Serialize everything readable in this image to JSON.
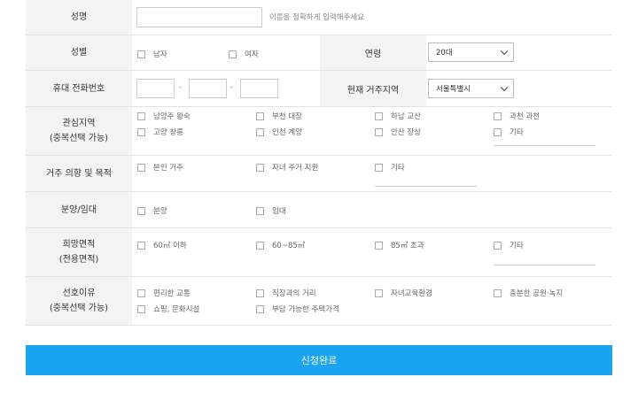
{
  "name": {
    "label": "성명",
    "placeholder": "",
    "hint": "이름을 정확하게 입력해주세요"
  },
  "gender": {
    "label": "성별",
    "options": [
      "남자",
      "여자"
    ]
  },
  "age": {
    "label": "연령",
    "selected": "20대"
  },
  "phone": {
    "label": "휴대 전화번호",
    "sep": "-"
  },
  "residence": {
    "label": "현재 거주지역",
    "selected": "서울특별시"
  },
  "interest_area": {
    "label_lines": [
      "관심지역",
      "(중복선택 가능)"
    ],
    "options": [
      "남양주 왕숙",
      "부천 대장",
      "하남 교산",
      "과천 과천",
      "고양 창릉",
      "인천 계양",
      "안산 장상",
      "기타"
    ]
  },
  "purpose": {
    "label": "거주 의향 및 목적",
    "options": [
      "본인 거주",
      "자녀 주거 지원",
      "기타"
    ]
  },
  "sale_type": {
    "label": "분양/임대",
    "options": [
      "분양",
      "임대"
    ]
  },
  "area": {
    "label_lines": [
      "희망면적",
      "(전용면적)"
    ],
    "options": [
      "60㎡ 이하",
      "60~85㎡",
      "85㎡ 초과",
      "기타"
    ]
  },
  "reason": {
    "label_lines": [
      "선호이유",
      "(중복선택 가능)"
    ],
    "options": [
      "편리한 교통",
      "직장과의 거리",
      "자녀교육환경",
      "충분한 공원·녹지",
      "쇼핑, 문화시설",
      "부담 가능한 주택가격"
    ]
  },
  "submit_label": "신청완료"
}
